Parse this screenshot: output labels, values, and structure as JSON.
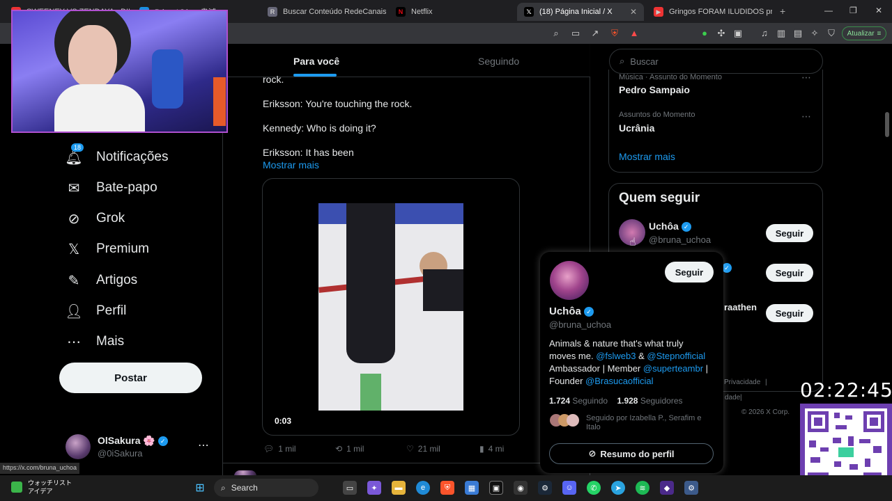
{
  "browser": {
    "tabs": [
      {
        "label": "SWEENEY VS ZENDAYA - DIREITA"
      },
      {
        "label": "Prime Video: 鬼滅"
      },
      {
        "label": "Buscar Conteúdo RedeCanais: star"
      },
      {
        "label": "Netflix"
      },
      {
        "label": "(18) Página Inicial / X"
      },
      {
        "label": "Gringos FORAM ILUDIDOS pro Rio"
      }
    ],
    "update_label": "Atualizar",
    "new_tab": "+"
  },
  "nav": {
    "items": [
      {
        "label": "Notificações",
        "icon": "bell-icon",
        "badge": "18"
      },
      {
        "label": "Bate-papo",
        "icon": "mail-icon"
      },
      {
        "label": "Grok",
        "icon": "grok-icon"
      },
      {
        "label": "Premium",
        "icon": "x-logo-icon"
      },
      {
        "label": "Artigos",
        "icon": "article-icon"
      },
      {
        "label": "Perfil",
        "icon": "person-icon"
      },
      {
        "label": "Mais",
        "icon": "more-circle-icon"
      }
    ],
    "post_label": "Postar",
    "me": {
      "name": "OlSakura 🌸",
      "handle": "@0iSakura"
    }
  },
  "feed": {
    "tabs": [
      "Para você",
      "Seguindo"
    ],
    "tweet_lines": [
      "rock.",
      "Eriksson: You're touching the rock.",
      "Kennedy: Who is doing it?",
      "Eriksson: It has been"
    ],
    "show_more": "Mostrar mais",
    "video_time": "0:03",
    "actions": {
      "replies": "1 mil",
      "reposts": "1 mil",
      "likes": "21 mil",
      "views": "4 mi"
    }
  },
  "sidebar": {
    "search_placeholder": "Buscar",
    "trends": [
      {
        "category": "Música · Assunto do Momento",
        "name": "Pedro Sampaio"
      },
      {
        "category": "Assuntos do Momento",
        "name": "Ucrânia"
      }
    ],
    "show_more": "Mostrar mais",
    "who_to_follow_title": "Quem seguir",
    "suggestion": {
      "name": "Uchôa",
      "handle": "@bruna_uchoa"
    },
    "partial_name": "raathen",
    "follow_label": "Seguir",
    "footer": [
      "Privacidade",
      "|",
      "dade",
      "|",
      "© 2026 X Corp."
    ]
  },
  "hovercard": {
    "name": "Uchôa",
    "handle": "@bruna_uchoa",
    "follow_label": "Seguir",
    "bio": {
      "line1": "Animals & nature that's what truly",
      "line2_prefix": "moves me. ",
      "mention1": "@fslweb3",
      "amp": " & ",
      "mention2": "@Stepnofficial",
      "line3_prefix": "Ambassador | Member ",
      "mention3": "@superteambr",
      "line3_suffix": " |",
      "line4_prefix": "Founder ",
      "mention4": "@Brasucaofficial"
    },
    "following_count": "1.724",
    "following_label": "Seguindo",
    "followers_count": "1.928",
    "followers_label": "Seguidores",
    "followed_by": "Seguido por Izabella P., Serafim e Italo",
    "profile_summary": "Resumo do perfil"
  },
  "overlay": {
    "clock": "02:22:45",
    "status_url": "https://x.com/bruna_uchoa"
  },
  "taskbar": {
    "widget_title": "ウォッチリスト",
    "widget_sub": "アイデア",
    "search_label": "Search"
  },
  "colors": {
    "accent": "#1d9bf0",
    "background": "#000000",
    "border": "#2f3336"
  }
}
